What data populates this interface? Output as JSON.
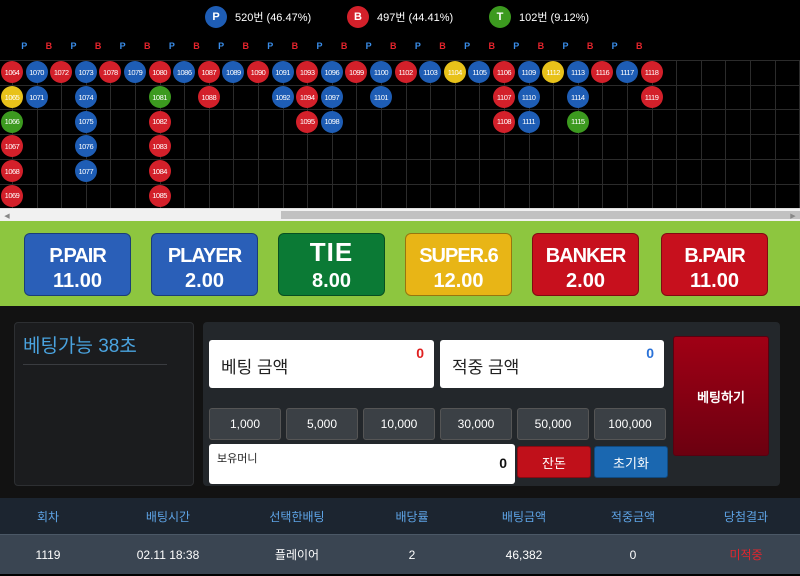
{
  "stats": {
    "player": {
      "letter": "P",
      "text": "520번 (46.47%)"
    },
    "banker": {
      "letter": "B",
      "text": "497번 (44.41%)"
    },
    "tie": {
      "letter": "T",
      "text": "102번 (9.12%)"
    }
  },
  "colors": {
    "player": "#1e5db5",
    "banker": "#d3202a",
    "tie": "#3c9a1f",
    "super6": "#e8c21a"
  },
  "road_header": [
    "P",
    "B",
    "P",
    "B",
    "P",
    "B",
    "P",
    "B",
    "P",
    "B",
    "P",
    "B",
    "P",
    "B",
    "P",
    "B",
    "P",
    "B",
    "P",
    "B",
    "P",
    "B",
    "P",
    "B",
    "P",
    "B"
  ],
  "bead_road": [
    [
      {
        "n": "1064",
        "c": "banker"
      },
      {
        "n": "1065",
        "c": "super6"
      },
      {
        "n": "1066",
        "c": "tie"
      },
      {
        "n": "1067",
        "c": "banker"
      },
      {
        "n": "1068",
        "c": "banker"
      },
      {
        "n": "1069",
        "c": "banker"
      }
    ],
    [
      {
        "n": "1070",
        "c": "player"
      },
      {
        "n": "1071",
        "c": "player"
      }
    ],
    [
      {
        "n": "1072",
        "c": "banker"
      }
    ],
    [
      {
        "n": "1073",
        "c": "player"
      },
      {
        "n": "1074",
        "c": "player"
      },
      {
        "n": "1075",
        "c": "player"
      },
      {
        "n": "1076",
        "c": "player"
      },
      {
        "n": "1077",
        "c": "player"
      }
    ],
    [
      {
        "n": "1078",
        "c": "banker"
      }
    ],
    [
      {
        "n": "1079",
        "c": "player"
      }
    ],
    [
      {
        "n": "1080",
        "c": "banker"
      },
      {
        "n": "1081",
        "c": "tie"
      },
      {
        "n": "1082",
        "c": "banker"
      },
      {
        "n": "1083",
        "c": "banker"
      },
      {
        "n": "1084",
        "c": "banker"
      },
      {
        "n": "1085",
        "c": "banker"
      }
    ],
    [
      {
        "n": "1086",
        "c": "player"
      }
    ],
    [
      {
        "n": "1087",
        "c": "banker"
      },
      {
        "n": "1088",
        "c": "banker"
      }
    ],
    [
      {
        "n": "1089",
        "c": "player"
      }
    ],
    [
      {
        "n": "1090",
        "c": "banker"
      }
    ],
    [
      {
        "n": "1091",
        "c": "player"
      },
      {
        "n": "1092",
        "c": "player"
      }
    ],
    [
      {
        "n": "1093",
        "c": "banker"
      },
      {
        "n": "1094",
        "c": "banker"
      },
      {
        "n": "1095",
        "c": "banker"
      }
    ],
    [
      {
        "n": "1096",
        "c": "player"
      },
      {
        "n": "1097",
        "c": "player"
      },
      {
        "n": "1098",
        "c": "player"
      }
    ],
    [
      {
        "n": "1099",
        "c": "banker"
      }
    ],
    [
      {
        "n": "1100",
        "c": "player"
      },
      {
        "n": "1101",
        "c": "player"
      }
    ],
    [
      {
        "n": "1102",
        "c": "banker"
      }
    ],
    [
      {
        "n": "1103",
        "c": "player"
      }
    ],
    [
      {
        "n": "1104",
        "c": "super6"
      }
    ],
    [
      {
        "n": "1105",
        "c": "player"
      }
    ],
    [
      {
        "n": "1106",
        "c": "banker"
      },
      {
        "n": "1107",
        "c": "banker"
      },
      {
        "n": "1108",
        "c": "banker"
      }
    ],
    [
      {
        "n": "1109",
        "c": "player"
      },
      {
        "n": "1110",
        "c": "player"
      },
      {
        "n": "1111",
        "c": "player"
      }
    ],
    [
      {
        "n": "1112",
        "c": "super6"
      }
    ],
    [
      {
        "n": "1113",
        "c": "player"
      },
      {
        "n": "1114",
        "c": "player"
      },
      {
        "n": "1115",
        "c": "tie"
      }
    ],
    [
      {
        "n": "1116",
        "c": "banker"
      }
    ],
    [
      {
        "n": "1117",
        "c": "player"
      }
    ],
    [
      {
        "n": "1118",
        "c": "banker"
      },
      {
        "n": "1119",
        "c": "banker"
      }
    ]
  ],
  "options": [
    {
      "name": "P.PAIR",
      "odds": "11.00",
      "color": "#2a5fb8"
    },
    {
      "name": "PLAYER",
      "odds": "2.00",
      "color": "#2a5fb8"
    },
    {
      "name": "TIE",
      "odds": "8.00",
      "color": "#0b7a35"
    },
    {
      "name": "SUPER.6",
      "odds": "12.00",
      "color": "#e8b516"
    },
    {
      "name": "BANKER",
      "odds": "2.00",
      "color": "#c7101d"
    },
    {
      "name": "B.PAIR",
      "odds": "11.00",
      "color": "#c7101d"
    }
  ],
  "bet": {
    "timer": "베팅가능 38초",
    "amount_label": "베팅 금액",
    "amount_value": "0",
    "win_label": "적중 금액",
    "win_value": "0",
    "chips": [
      "1,000",
      "5,000",
      "10,000",
      "30,000",
      "50,000",
      "100,000"
    ],
    "wallet_label": "보유머니",
    "wallet_value": "0",
    "change_label": "잔돈",
    "reset_label": "초기화",
    "submit_label": "베팅하기"
  },
  "history": {
    "headers": [
      "회차",
      "배팅시간",
      "선택한배팅",
      "배당률",
      "배팅금액",
      "적중금액",
      "당첨결과"
    ],
    "rows": [
      [
        "1119",
        "02.11 18:38",
        "플레이어",
        "2",
        "46,382",
        "0",
        "미적중"
      ]
    ]
  }
}
